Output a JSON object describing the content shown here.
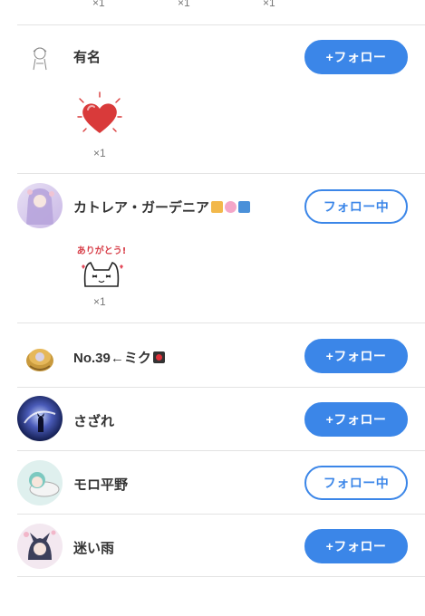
{
  "top_counts": [
    "×1",
    "×1",
    "×1"
  ],
  "users": [
    {
      "name": "有名",
      "button": "+フォロー",
      "state": "follow",
      "stamp": "heart-stamp",
      "stamp_count": "×1"
    },
    {
      "name": "カトレア・ガーデニア",
      "button": "フォロー中",
      "state": "following",
      "stamp": "arigatou-cat-stamp",
      "stamp_text": "ありがとう!",
      "stamp_count": "×1"
    },
    {
      "name": "No.39←ミク",
      "button": "+フォロー",
      "state": "follow"
    },
    {
      "name": "さざれ",
      "button": "+フォロー",
      "state": "follow"
    },
    {
      "name": "モロ平野",
      "button": "フォロー中",
      "state": "following"
    },
    {
      "name": "迷い雨",
      "button": "+フォロー",
      "state": "follow"
    }
  ],
  "colors": {
    "accent": "#3b86e8",
    "divider": "#e3e3e3",
    "heart": "#d93a3a"
  }
}
